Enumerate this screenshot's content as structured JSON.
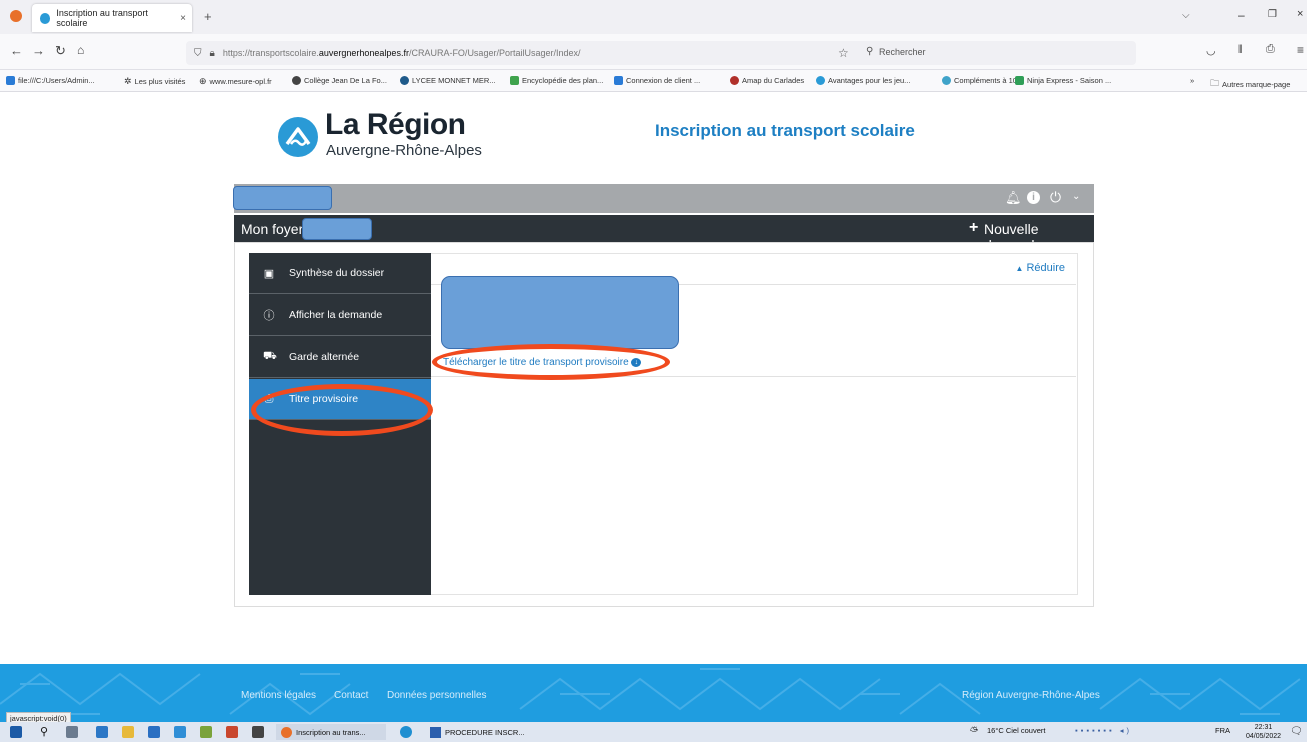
{
  "browser": {
    "tab_title": "Inscription au transport scolaire",
    "tab_close": "×",
    "new_tab": "+",
    "url_prefix": "https://transportscolaire.",
    "url_host": "auvergnerhonealpes.fr",
    "url_path": "/CRAURA-FO/Usager/PortailUsager/Index/",
    "search_placeholder": "Rechercher",
    "bookmarks": [
      "file:///C:/Users/Admin...",
      "Les plus visités",
      "www.mesure-opl.fr",
      "Collège Jean De La Fo...",
      "LYCEE MONNET MER...",
      "Encyclopédie des plan...",
      "Connexion de client ...",
      "Amap du Carlades",
      "Avantages pour les jeu...",
      "Compléments à 10",
      "Ninja Express - Saison ..."
    ],
    "other_bookmarks": "Autres marque-page"
  },
  "header": {
    "logo_title": "La Région",
    "logo_subtitle": "Auvergne-Rhône-Alpes",
    "page_title": "Inscription au transport scolaire"
  },
  "foyer_bar": {
    "label": "Mon foyer -",
    "new_request": "Nouvelle demande"
  },
  "sidebar": {
    "items": [
      {
        "label": "Synthèse du dossier"
      },
      {
        "label": "Afficher la demande"
      },
      {
        "label": "Garde alternée"
      },
      {
        "label": "Titre provisoire"
      }
    ]
  },
  "content": {
    "collapse_label": "Réduire",
    "download_link": "Télécharger le titre de transport provisoire"
  },
  "footer": {
    "links": [
      "Mentions légales",
      "Contact",
      "Données personnelles"
    ],
    "brand": "Région Auvergne-Rhône-Alpes"
  },
  "status_link": "javascript:void(0)",
  "taskbar": {
    "app1": "Inscription au trans...",
    "app2": "PROCEDURE INSCR...",
    "weather": "16°C  Ciel couvert",
    "lang": "FRA",
    "time": "22:31",
    "date": "04/05/2022"
  },
  "colors": {
    "accent": "#1f7bc1",
    "active_nav": "#2e84c6",
    "dark_bar": "#2c3339",
    "footer": "#1f9de0",
    "annotation": "#f04a1e"
  }
}
